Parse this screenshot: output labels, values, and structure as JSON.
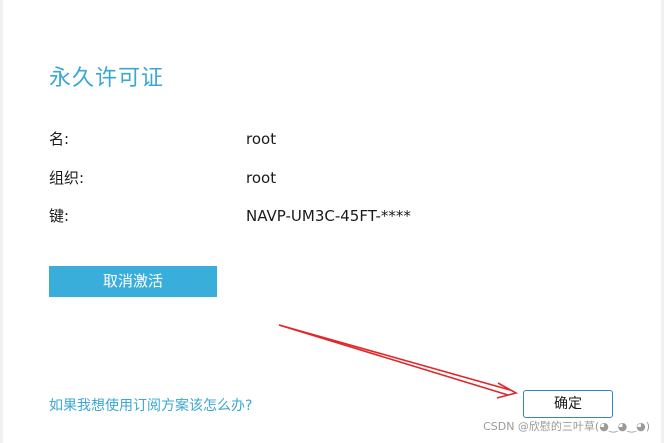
{
  "dialog": {
    "title": "永久许可证",
    "fields": [
      {
        "label": "名:",
        "value": "root"
      },
      {
        "label": "组织:",
        "value": "root"
      },
      {
        "label": "键:",
        "value": "NAVP-UM3C-45FT-****"
      }
    ],
    "deactivate_label": "取消激活",
    "subscription_link": "如果我想使用订阅方案该怎么办?",
    "ok_label": "确定"
  },
  "watermark": "CSDN @欣慰的三叶草(◕‿◕‿◕)",
  "colors": {
    "accent": "#3aa7d4",
    "button": "#3aaedb",
    "arrow": "#e0282a"
  }
}
